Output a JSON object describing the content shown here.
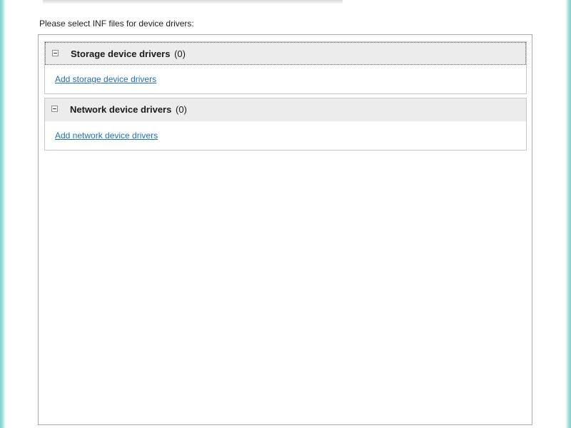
{
  "instruction": "Please select INF files for device drivers:",
  "groups": [
    {
      "name": "Storage device drivers",
      "count": "(0)",
      "expanded": true,
      "link": "Add storage device drivers",
      "icon": "collapse-minus-icon"
    },
    {
      "name": "Network device drivers",
      "count": "(0)",
      "expanded": true,
      "link": "Add network device drivers",
      "icon": "collapse-minus-icon"
    }
  ],
  "colors": {
    "link": "#1f6fb3",
    "frame_accent": "#7fcfc8",
    "header_bg": "#ececec"
  }
}
